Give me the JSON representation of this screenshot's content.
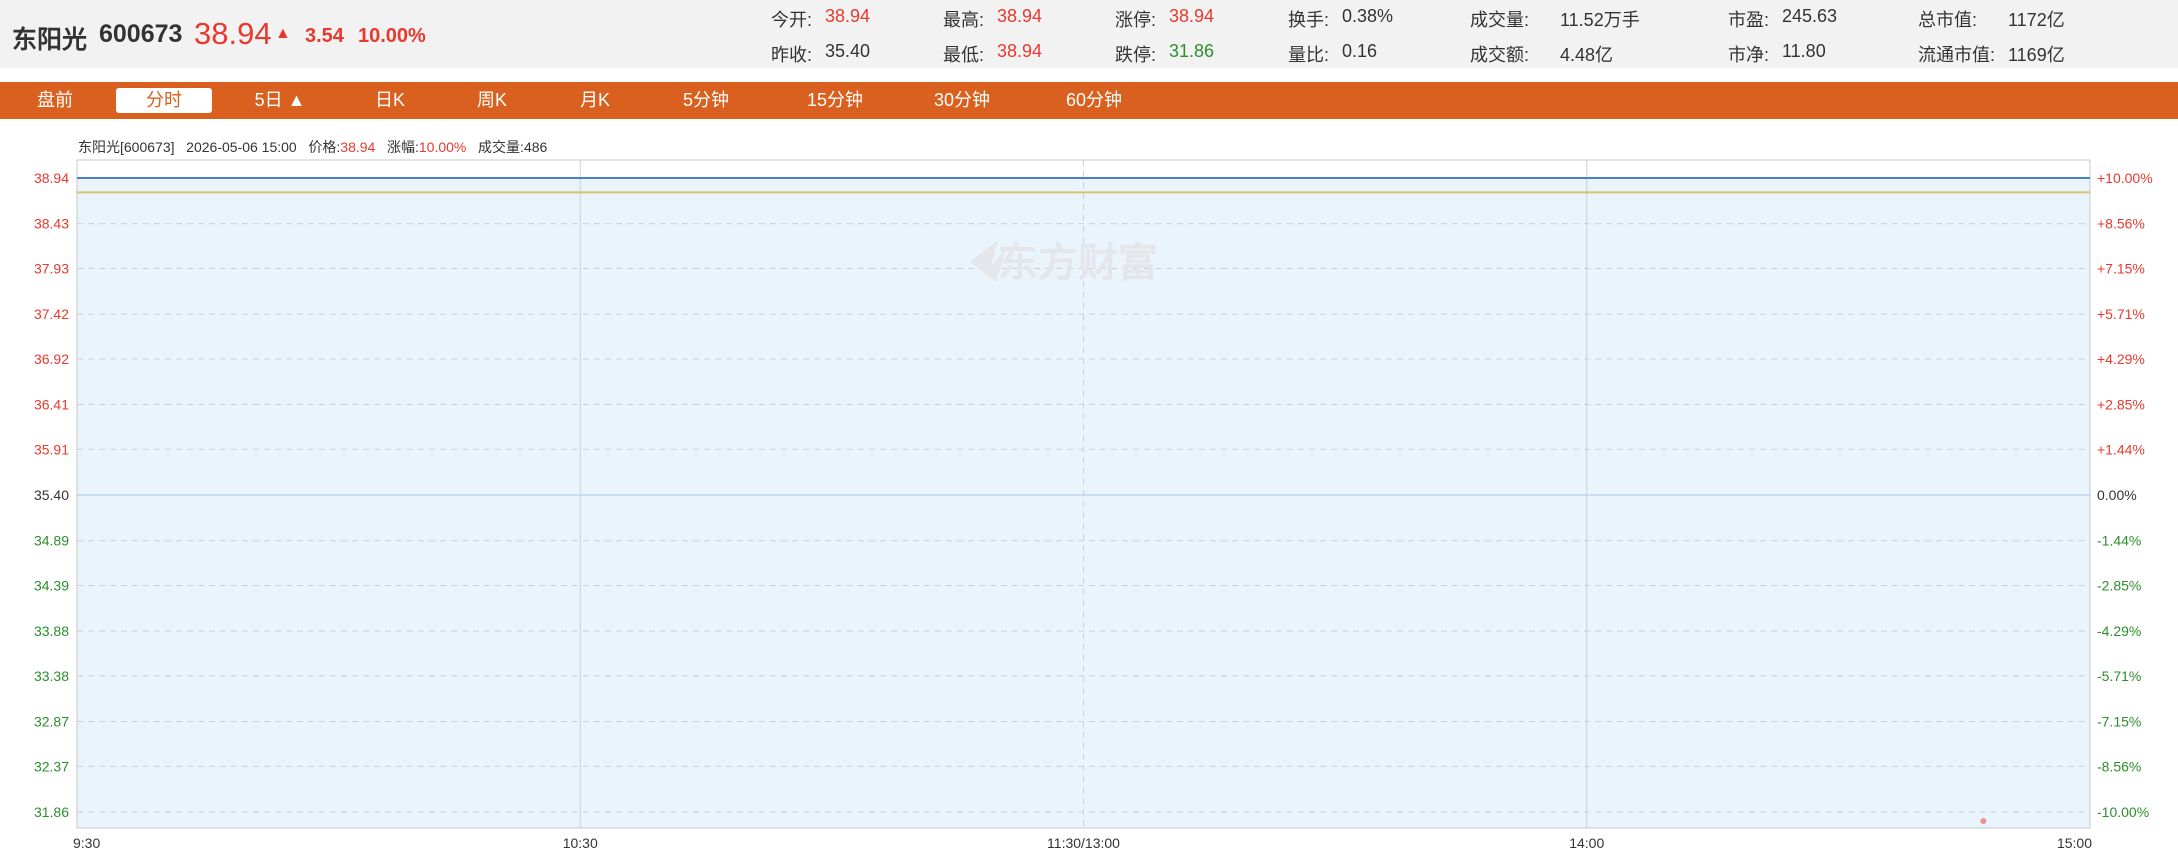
{
  "stock": {
    "name": "东阳光",
    "code": "600673",
    "price": "38.94",
    "change": "3.54",
    "change_pct": "10.00%"
  },
  "stats": [
    {
      "label": "今开:",
      "value": "38.94",
      "color": "red"
    },
    {
      "label": "最高:",
      "value": "38.94",
      "color": "red"
    },
    {
      "label": "涨停:",
      "value": "38.94",
      "color": "red"
    },
    {
      "label": "换手:",
      "value": "0.38%",
      "color": "black"
    },
    {
      "label": "成交量:",
      "value": "11.52万手",
      "color": "black"
    },
    {
      "label": "市盈:",
      "value": "245.63",
      "color": "black"
    },
    {
      "label": "总市值:",
      "value": "1172亿",
      "color": "black"
    },
    {
      "label": "昨收:",
      "value": "35.40",
      "color": "black"
    },
    {
      "label": "最低:",
      "value": "38.94",
      "color": "red"
    },
    {
      "label": "跌停:",
      "value": "31.86",
      "color": "green"
    },
    {
      "label": "量比:",
      "value": "0.16",
      "color": "black"
    },
    {
      "label": "成交额:",
      "value": "4.48亿",
      "color": "black"
    },
    {
      "label": "市净:",
      "value": "11.80",
      "color": "black"
    },
    {
      "label": "流通市值:",
      "value": "1169亿",
      "color": "black"
    }
  ],
  "tabs": [
    "盘前",
    "分时",
    "5日 ▲",
    "日K",
    "周K",
    "月K",
    "5分钟",
    "15分钟",
    "30分钟",
    "60分钟"
  ],
  "active_tab": "分时",
  "info": {
    "name_code": "东阳光[600673]",
    "datetime": "2026-05-06 15:00",
    "price_label": "价格:",
    "price": "38.94",
    "change_label": "涨幅:",
    "change": "10.00%",
    "volume_label": "成交量:",
    "volume": "486"
  },
  "watermark": "东方财富",
  "colors": {
    "up": "#e8392e",
    "down": "#2c8f2c",
    "accent": "#d9601e",
    "price_line": "#4a7fd0",
    "avg_line": "#d4c46a",
    "fill": "#eaf4fd"
  },
  "chart_data": {
    "type": "line",
    "ylim": [
      31.86,
      38.94
    ],
    "y_ticks": [
      "38.94",
      "38.43",
      "37.93",
      "37.42",
      "36.92",
      "36.41",
      "35.91",
      "35.40",
      "34.89",
      "34.39",
      "33.88",
      "33.38",
      "32.87",
      "32.37",
      "31.86"
    ],
    "y_ticks_right": [
      "+10.00%",
      "+8.56%",
      "+7.15%",
      "+5.71%",
      "+4.29%",
      "+2.85%",
      "+1.44%",
      "0.00%",
      "-1.44%",
      "-2.85%",
      "-4.29%",
      "-5.71%",
      "-7.15%",
      "-8.56%",
      "-10.00%"
    ],
    "x_ticks": [
      "9:30",
      "10:30",
      "11:30/13:00",
      "14:00",
      "15:00"
    ],
    "prev_close": 35.4,
    "series": [
      {
        "values": [
          38.94,
          38.94
        ],
        "x_range": [
          0,
          1
        ]
      },
      {
        "values": [
          38.78,
          38.78
        ],
        "x_range": [
          0,
          1
        ]
      }
    ],
    "volume_markers": [
      {
        "x_fraction": 0.947
      }
    ]
  }
}
